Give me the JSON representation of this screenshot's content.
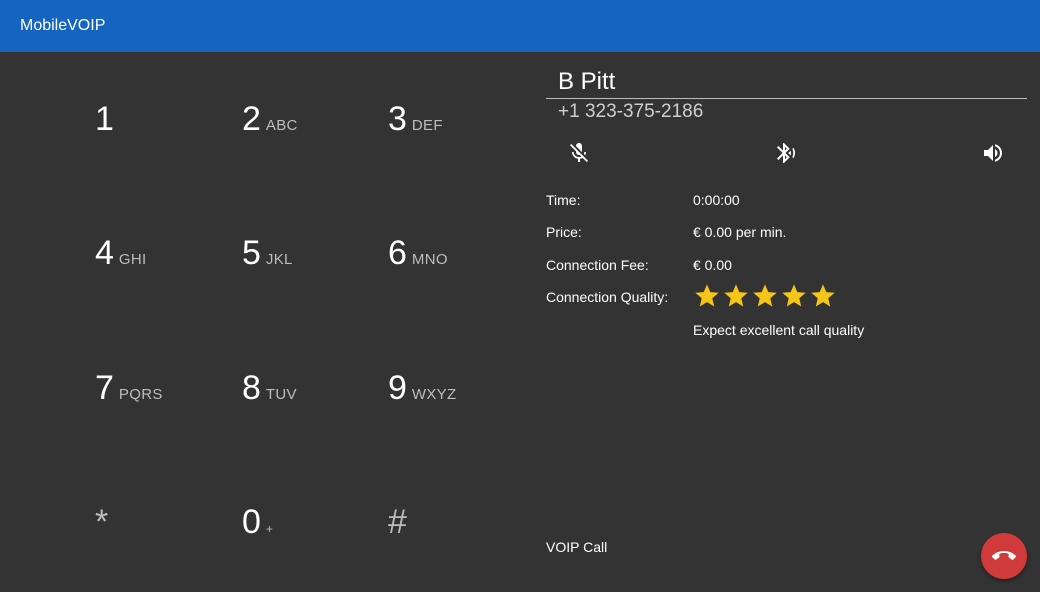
{
  "app": {
    "title": "MobileVOIP"
  },
  "dialpad": {
    "keys": [
      {
        "digit": "1",
        "letters": ""
      },
      {
        "digit": "2",
        "letters": "ABC"
      },
      {
        "digit": "3",
        "letters": "DEF"
      },
      {
        "digit": "4",
        "letters": "GHI"
      },
      {
        "digit": "5",
        "letters": "JKL"
      },
      {
        "digit": "6",
        "letters": "MNO"
      },
      {
        "digit": "7",
        "letters": "PQRS"
      },
      {
        "digit": "8",
        "letters": "TUV"
      },
      {
        "digit": "9",
        "letters": "WXYZ"
      },
      {
        "digit": "*",
        "letters": ""
      },
      {
        "digit": "0",
        "letters": "+"
      },
      {
        "digit": "#",
        "letters": ""
      }
    ]
  },
  "contact": {
    "name": "B Pitt",
    "number": "+1 323-375-2186"
  },
  "controls": {
    "mute_icon": "mic-off-icon",
    "bluetooth_icon": "bluetooth-icon",
    "speaker_icon": "speaker-icon"
  },
  "call_info": {
    "time_label": "Time:",
    "time_value": "0:00:00",
    "price_label": "Price:",
    "price_value": "€ 0.00 per min.",
    "fee_label": "Connection Fee:",
    "fee_value": "€ 0.00",
    "quality_label": "Connection Quality:",
    "quality_stars": 5,
    "quality_max": 5,
    "quality_text": "Expect excellent call quality"
  },
  "call_type": "VOIP Call",
  "colors": {
    "appbar": "#1565c0",
    "background": "#333333",
    "star": "#f5c518",
    "hangup": "#d13a3a"
  }
}
